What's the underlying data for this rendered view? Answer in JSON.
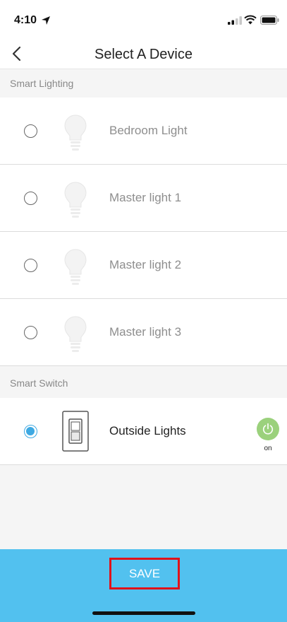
{
  "status_bar": {
    "time": "4:10",
    "icons": [
      "location-arrow-icon",
      "signal-bars-icon",
      "wifi-icon",
      "battery-icon"
    ]
  },
  "nav": {
    "title": "Select A Device",
    "back_icon": "chevron-left-icon"
  },
  "sections": [
    {
      "header": "Smart Lighting",
      "devices": [
        {
          "label": "Bedroom Light",
          "icon": "light-bulb-icon",
          "selected": false
        },
        {
          "label": "Master light 1",
          "icon": "light-bulb-icon",
          "selected": false
        },
        {
          "label": "Master light 2",
          "icon": "light-bulb-icon",
          "selected": false
        },
        {
          "label": "Master light 3",
          "icon": "light-bulb-icon",
          "selected": false
        }
      ]
    },
    {
      "header": "Smart Switch",
      "devices": [
        {
          "label": "Outside Lights",
          "icon": "light-switch-icon",
          "selected": true,
          "power_state": "on"
        }
      ]
    }
  ],
  "footer": {
    "save_label": "SAVE"
  },
  "colors": {
    "accent": "#3ea9e2",
    "footer_bg": "#52c1ef",
    "power_on": "#9bd17c",
    "highlight_border": "#e0121a"
  }
}
